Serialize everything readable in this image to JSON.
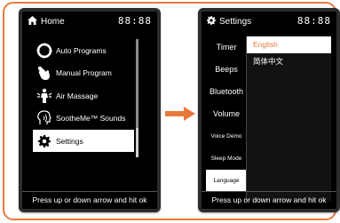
{
  "home_screen": {
    "title": "Home",
    "clock": "88:88",
    "menu": [
      {
        "label": "Auto Programs",
        "icon": "circular-arrows-icon",
        "selected": false
      },
      {
        "label": "Manual Program",
        "icon": "hand-pointer-icon",
        "selected": false
      },
      {
        "label": "Air Massage",
        "icon": "person-air-icon",
        "selected": false
      },
      {
        "label": "SootheMe™ Sounds",
        "icon": "head-sound-icon",
        "selected": false
      },
      {
        "label": "Settings",
        "icon": "gear-icon",
        "selected": true
      }
    ],
    "hint": "Press up or down arrow and hit ok"
  },
  "settings_screen": {
    "title": "Settings",
    "clock": "88:88",
    "sidebar": [
      {
        "label": "Timer",
        "selected": false
      },
      {
        "label": "Beeps",
        "selected": false
      },
      {
        "label": "Bluetooth",
        "selected": false
      },
      {
        "label": "Volume",
        "selected": false
      },
      {
        "label": "Voice Demo",
        "selected": false
      },
      {
        "label": "Sleep Mode",
        "selected": false
      },
      {
        "label": "Language",
        "selected": true
      }
    ],
    "languages": [
      {
        "label": "English",
        "selected": true
      },
      {
        "label": "简体中文",
        "selected": false
      }
    ],
    "hint": "Press up or down arrow and hit ok"
  },
  "colors": {
    "accent": "#e8793a",
    "screen_bg": "#000000",
    "bezel": "#2c2c2c",
    "selected_bg": "#ffffff"
  }
}
